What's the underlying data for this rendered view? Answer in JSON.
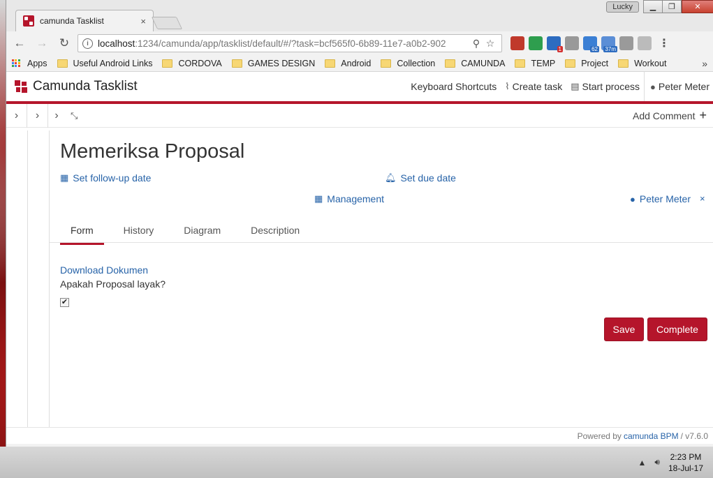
{
  "browser": {
    "tab_title": "camunda Tasklist",
    "tab_close": "×",
    "profile_name": "Lucky",
    "url_host": "localhost",
    "url_rest": ":1234/camunda/app/tasklist/default/#/?task=bcf565f0-6b89-11e7-a0b2-902",
    "bookmarks": [
      {
        "label": "Apps",
        "icon": "apps-grid-icon"
      },
      {
        "label": "Useful Android Links",
        "icon": "folder-icon"
      },
      {
        "label": "CORDOVA",
        "icon": "folder-icon"
      },
      {
        "label": "GAMES DESIGN",
        "icon": "folder-icon"
      },
      {
        "label": "Android",
        "icon": "folder-icon"
      },
      {
        "label": "Collection",
        "icon": "folder-icon"
      },
      {
        "label": "CAMUNDA",
        "icon": "folder-icon"
      },
      {
        "label": "TEMP",
        "icon": "folder-icon"
      },
      {
        "label": "Project",
        "icon": "folder-icon"
      },
      {
        "label": "Workout",
        "icon": "folder-icon"
      }
    ],
    "bookmarks_more": "»",
    "extensions": [
      {
        "icon": "book-extension-icon",
        "color": "#c0392b",
        "badge": ""
      },
      {
        "icon": "drive-extension-icon",
        "color": "#2e9e4e",
        "badge": ""
      },
      {
        "icon": "calendar-365-extension-icon",
        "color": "#2d6cc0",
        "badge": "1"
      },
      {
        "icon": "cloud-extension-icon",
        "color": "#999999",
        "badge": ""
      },
      {
        "icon": "signal-extension-icon",
        "color": "#3b7fd4",
        "badge": "62"
      },
      {
        "icon": "timer-extension-icon",
        "color": "#5b8ed6",
        "badge": "37m"
      },
      {
        "icon": "shield-extension-icon",
        "color": "#9a9a9a",
        "badge": ""
      },
      {
        "icon": "move-extension-icon",
        "color": "#bbbbbb",
        "badge": ""
      }
    ]
  },
  "app": {
    "brand": "Camunda Tasklist",
    "nav": {
      "keyboard_shortcuts": "Keyboard Shortcuts",
      "create_task": "Create task",
      "start_process": "Start process",
      "user": "Peter Meter"
    },
    "add_comment": "Add Comment"
  },
  "task": {
    "title": "Memeriksa Proposal",
    "follow_up": "Set follow-up date",
    "due_date": "Set due date",
    "group": "Management",
    "assignee": "Peter Meter",
    "remove_assignee": "×",
    "tabs": [
      "Form",
      "History",
      "Diagram",
      "Description"
    ],
    "active_tab": "Form"
  },
  "form": {
    "download_link": "Download Dokumen",
    "question": "Apakah Proposal layak?",
    "checkbox_checked": true,
    "save_label": "Save",
    "complete_label": "Complete"
  },
  "footer": {
    "prefix": "Powered by",
    "brand": "camunda BPM",
    "version": "/ v7.6.0"
  },
  "taskbar": {
    "time": "2:23 PM",
    "date": "18-Jul-17"
  },
  "colors": {
    "brand_red": "#b5152b",
    "link_blue": "#2763a8"
  }
}
